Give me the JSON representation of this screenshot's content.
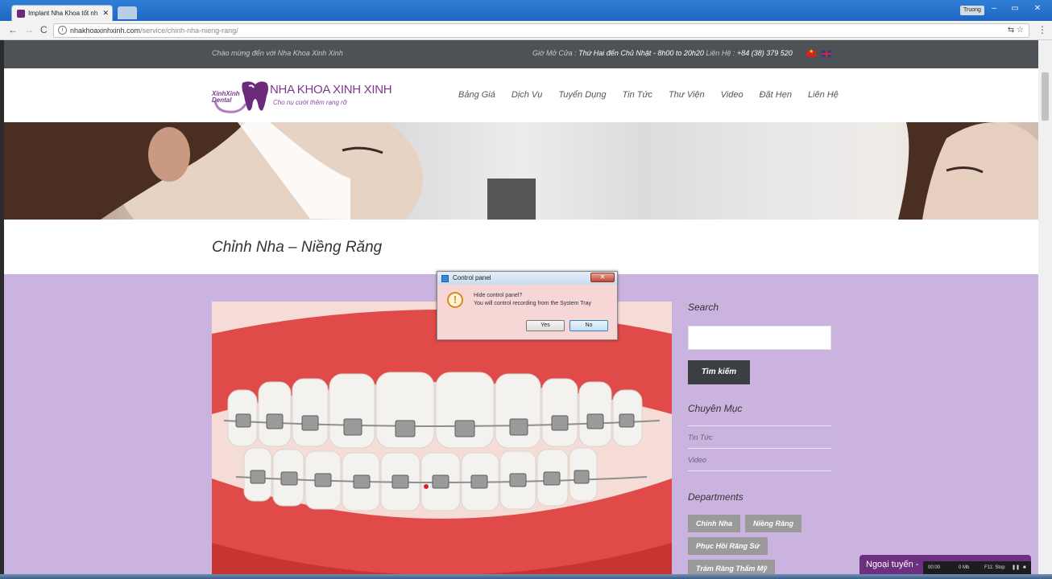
{
  "browser": {
    "tab_title": "Implant Nha Khoa tốt nh",
    "tab_close": "✕",
    "user_badge": "Truong",
    "url_domain": "nhakhoaxinhxinh.com",
    "url_path": "/service/chinh-nha-nieng-rang/",
    "back_icon": "←",
    "forward_icon": "→",
    "reload_icon": "C"
  },
  "topbar": {
    "welcome": "Chào mừng đến với Nha Khoa Xinh Xinh",
    "hours_label": "Giờ Mở Cửa : ",
    "hours_value": "Thứ Hai đến Chủ Nhật - 8h00 to 20h20",
    "contact_label": "  Liên Hệ : ",
    "contact_value": "+84 (38) 379 520"
  },
  "logo": {
    "name": "NHA KHOA XINH XINH",
    "slogan": "Cho nụ cười thêm rạng rỡ",
    "mark_line1": "XinhXinh",
    "mark_line2": "Dental"
  },
  "nav": [
    "Bảng Giá",
    "Dịch Vụ",
    "Tuyển Dụng",
    "Tin Tức",
    "Thư Viện",
    "Video",
    "Đặt Hẹn",
    "Liên Hệ"
  ],
  "page_title": "Chỉnh Nha – Niềng Răng",
  "sidebar": {
    "search_heading": "Search",
    "search_value": "",
    "search_button": "Tìm kiếm",
    "categories_heading": "Chuyên Mục",
    "categories": [
      "Tin Tức",
      "Video"
    ],
    "departments_heading": "Departments",
    "departments": [
      "Chỉnh Nha",
      "Niềng Răng",
      "Phục Hồi Răng Sứ",
      "Trám Răng Thẩm Mỹ"
    ]
  },
  "dialog": {
    "title": "Control panel",
    "close": "✕",
    "icon": "warning-icon",
    "line1": "Hide control panel?",
    "line2": "You will control recording from the System Tray",
    "yes": "Yes",
    "no": "No"
  },
  "chat": {
    "label": "Ngoại tuyến -"
  },
  "recorder": {
    "time": "00:00",
    "size": "0 Mb",
    "stop": "F11: Stop",
    "pause": "❚❚",
    "stop_glyph": "■"
  }
}
